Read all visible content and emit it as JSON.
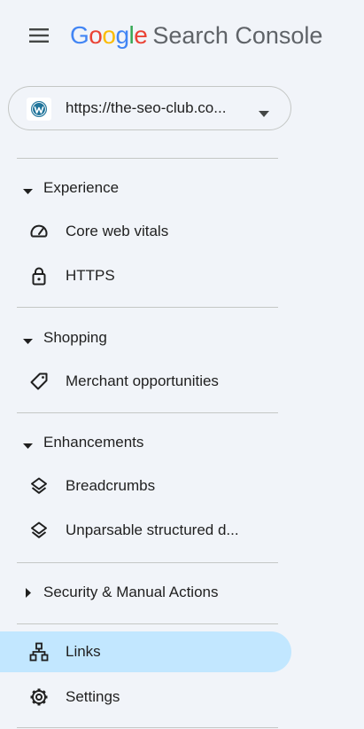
{
  "header": {
    "menu_icon": "hamburger-menu-icon",
    "logo_letters": [
      "G",
      "o",
      "o",
      "g",
      "l",
      "e"
    ],
    "logo_colors": [
      "#4285F4",
      "#EA4335",
      "#FBBC05",
      "#4285F4",
      "#34A853",
      "#EA4335"
    ],
    "product_name": "Search Console"
  },
  "property": {
    "icon": "wordpress-icon",
    "url": "https://the-seo-club.co...",
    "caret_icon": "dropdown-caret-icon"
  },
  "sections": [
    {
      "title": "Experience",
      "expanded": true,
      "items": [
        {
          "label": "Core web vitals",
          "icon": "speedometer-icon"
        },
        {
          "label": "HTTPS",
          "icon": "lock-icon"
        }
      ]
    },
    {
      "title": "Shopping",
      "expanded": true,
      "items": [
        {
          "label": "Merchant opportunities",
          "icon": "tag-icon"
        }
      ]
    },
    {
      "title": "Enhancements",
      "expanded": true,
      "items": [
        {
          "label": "Breadcrumbs",
          "icon": "layers-icon"
        },
        {
          "label": "Unparsable structured d...",
          "icon": "layers-icon"
        }
      ]
    },
    {
      "title": "Security & Manual Actions",
      "expanded": false,
      "items": []
    }
  ],
  "bottom_items": [
    {
      "label": "Links",
      "icon": "sitemap-icon",
      "active": true
    },
    {
      "label": "Settings",
      "icon": "gear-icon",
      "active": false
    }
  ],
  "colors": {
    "background": "#f1f4f9",
    "active_item": "#c2e7ff",
    "divider": "#c4c7c5"
  }
}
